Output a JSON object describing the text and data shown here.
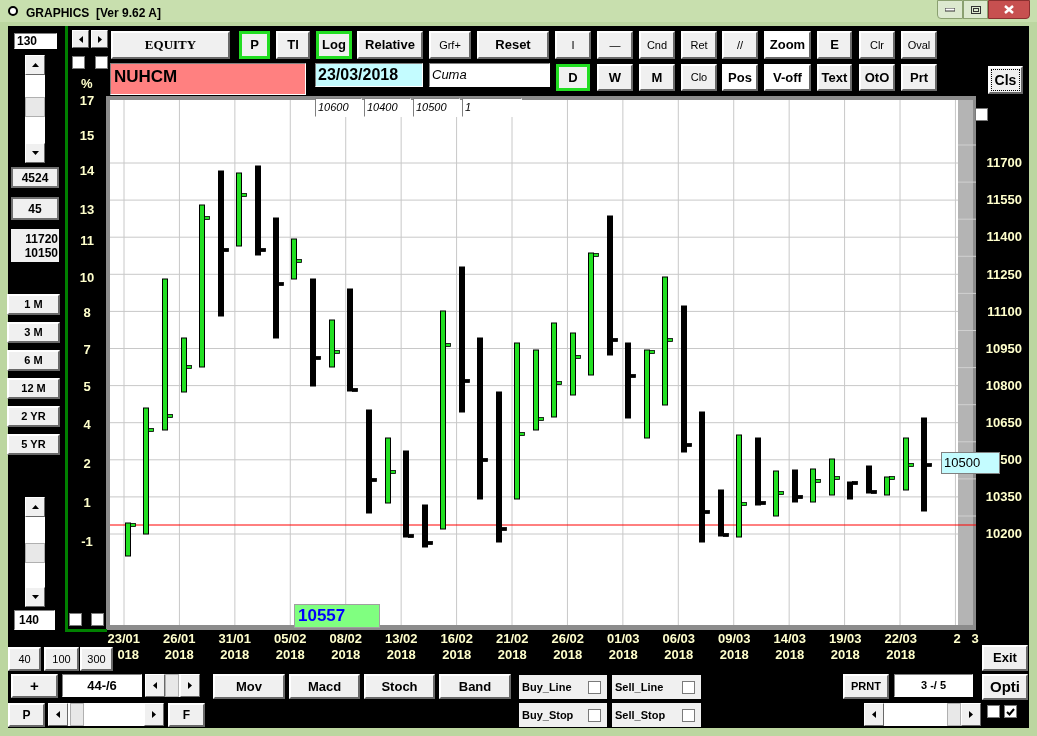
{
  "window": {
    "title": "GRAPHICS  [Ver 9.62 A]"
  },
  "left_panel": {
    "top_field": "130",
    "count": "4524",
    "step": "45",
    "range_high": "11720",
    "range_low": "10150",
    "periods": [
      "1 M",
      "3 M",
      "6 M",
      "12 M",
      "2 YR",
      "5 YR"
    ],
    "bottom_field": "140"
  },
  "top_checkboxes": [
    {
      "checked": false
    },
    {
      "checked": false
    }
  ],
  "axis_unit": "%",
  "toolbar_row1": [
    {
      "label": "EQUITY",
      "selected": false,
      "kind": "serif"
    },
    {
      "label": "P",
      "selected": true,
      "kind": "bold"
    },
    {
      "label": "Tl",
      "selected": false,
      "kind": "bold"
    },
    {
      "label": "Log",
      "selected": true,
      "kind": "bold"
    },
    {
      "label": "Relative",
      "selected": false,
      "kind": "bold"
    },
    {
      "label": "Grf+",
      "selected": false,
      "kind": "plain"
    },
    {
      "label": "Reset",
      "selected": false,
      "kind": "bold"
    },
    {
      "label": "I",
      "selected": false,
      "kind": "plain"
    },
    {
      "label": "—",
      "selected": false,
      "kind": "plain"
    },
    {
      "label": "Cnd",
      "selected": false,
      "kind": "plain"
    },
    {
      "label": "Ret",
      "selected": false,
      "kind": "plain"
    },
    {
      "label": "//",
      "selected": false,
      "kind": "plain"
    },
    {
      "label": "Zoom",
      "selected": false,
      "kind": "white"
    },
    {
      "label": "E",
      "selected": false,
      "kind": "bold"
    },
    {
      "label": "Clr",
      "selected": false,
      "kind": "plain"
    },
    {
      "label": "Oval",
      "selected": false,
      "kind": "plain"
    }
  ],
  "toolbar_row2": [
    {
      "label": "D",
      "selected": true,
      "kind": "bold"
    },
    {
      "label": "W",
      "selected": false,
      "kind": "bold"
    },
    {
      "label": "M",
      "selected": false,
      "kind": "bold"
    },
    {
      "label": "Clo",
      "selected": false,
      "kind": "plain"
    },
    {
      "label": "Pos",
      "selected": false,
      "kind": "white"
    },
    {
      "label": "V-off",
      "selected": false,
      "kind": "white"
    },
    {
      "label": "Text",
      "selected": false,
      "kind": "bold"
    },
    {
      "label": "OtO",
      "selected": false,
      "kind": "bold"
    },
    {
      "label": "Prt",
      "selected": false,
      "kind": "bold"
    }
  ],
  "cls_button": "Cls",
  "symbol": "NUHCM",
  "date": "23/03/2018",
  "weekday": "Cuma",
  "levels": [
    "10600",
    "10400",
    "10500",
    "1"
  ],
  "percent_ticks": [
    "17",
    "15",
    "14",
    "13",
    "11",
    "10",
    "8",
    "7",
    "5",
    "4",
    "2",
    "1",
    "-1"
  ],
  "price_ticks": [
    "11700",
    "11550",
    "11400",
    "11250",
    "11100",
    "10950",
    "10800",
    "10650",
    "500",
    "10350",
    "10200"
  ],
  "date_labels": [
    {
      "day": "23/01",
      "year": "018"
    },
    {
      "day": "26/01",
      "year": "2018"
    },
    {
      "day": "31/01",
      "year": "2018"
    },
    {
      "day": "05/02",
      "year": "2018"
    },
    {
      "day": "08/02",
      "year": "2018"
    },
    {
      "day": "13/02",
      "year": "2018"
    },
    {
      "day": "16/02",
      "year": "2018"
    },
    {
      "day": "21/02",
      "year": "2018"
    },
    {
      "day": "26/02",
      "year": "2018"
    },
    {
      "day": "01/03",
      "year": "2018"
    },
    {
      "day": "06/03",
      "year": "2018"
    },
    {
      "day": "09/03",
      "year": "2018"
    },
    {
      "day": "14/03",
      "year": "2018"
    },
    {
      "day": "19/03",
      "year": "2018"
    },
    {
      "day": "22/03",
      "year": "2018"
    },
    {
      "day": "2"
    },
    {
      "day": "3"
    }
  ],
  "plot_checkbox": {
    "checked": false
  },
  "last_price": "10500",
  "cursor_value": "10557",
  "bottom_left_checkboxes": [
    {
      "checked": false
    },
    {
      "checked": false
    }
  ],
  "zoom_buttons": [
    "40",
    "100",
    "300"
  ],
  "plus_button": "+",
  "counter": "44-/6",
  "indicator_buttons": [
    "Mov",
    "Macd",
    "Stoch",
    "Band"
  ],
  "options": [
    {
      "label": "Buy_Line",
      "checked": false
    },
    {
      "label": "Sell_Line",
      "checked": false
    },
    {
      "label": "Buy_Stop",
      "checked": false
    },
    {
      "label": "Sell_Stop",
      "checked": false
    }
  ],
  "prnt_button": "PRNT",
  "page": "3 -/ 5",
  "exit_button": "Exit",
  "opti_button": "Opti",
  "p_button": "P",
  "f_button": "F",
  "view_checkboxes": [
    {
      "checked": false
    },
    {
      "checked": true
    }
  ]
}
